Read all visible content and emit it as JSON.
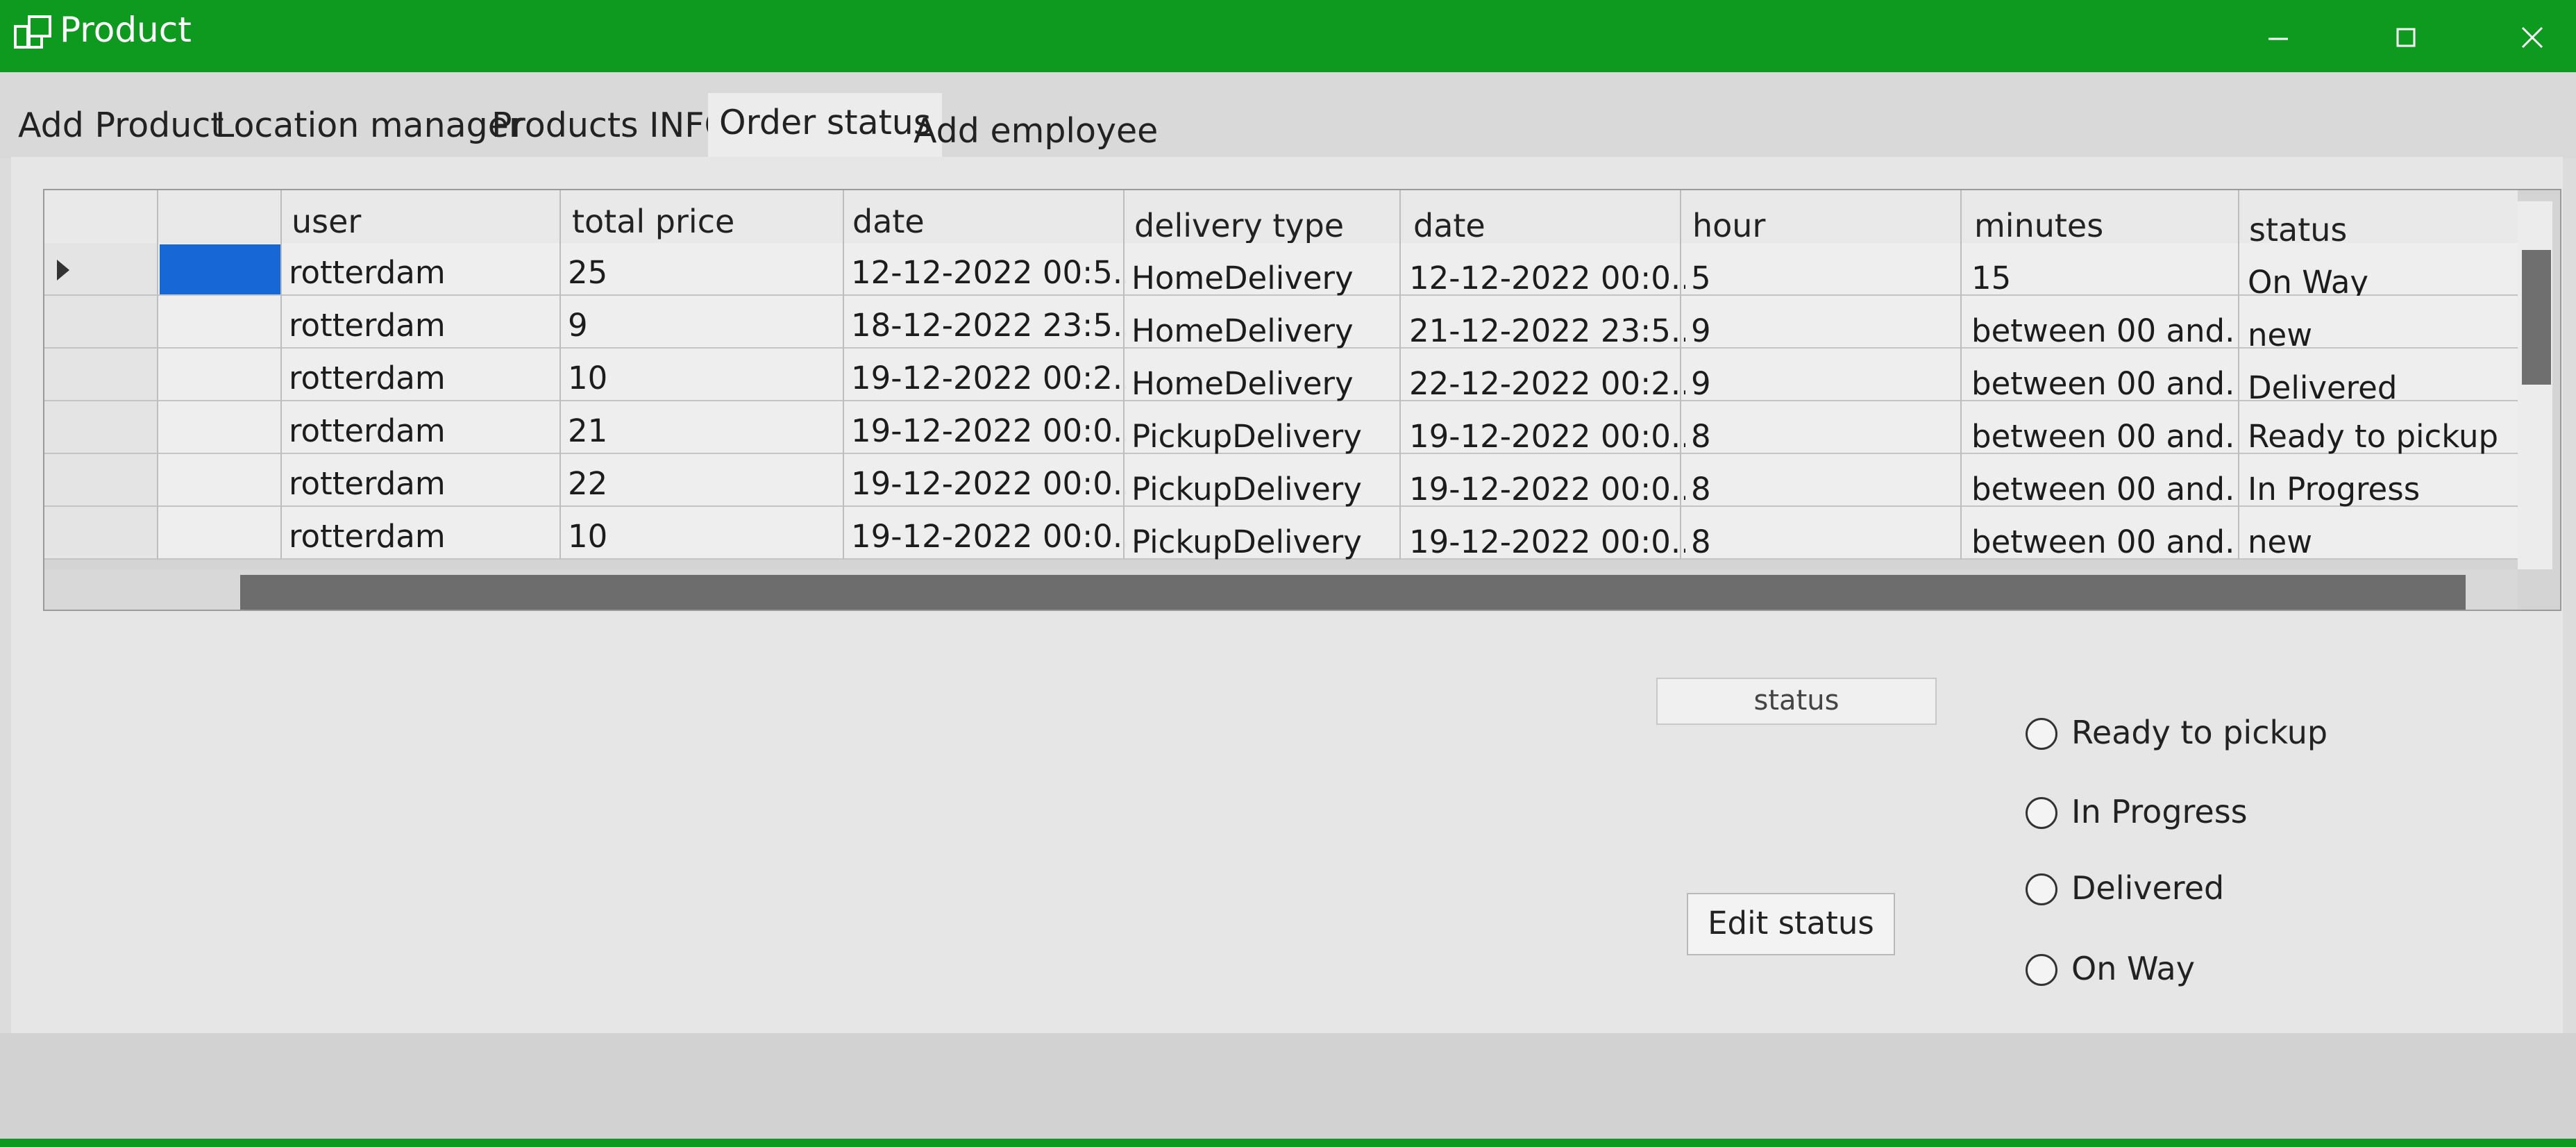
{
  "window": {
    "title": "Product",
    "controls": [
      "minimize",
      "maximize",
      "close"
    ]
  },
  "tabs": [
    {
      "label": "Add Product",
      "active": false
    },
    {
      "label": "Location manager",
      "active": false
    },
    {
      "label": "Products INFO",
      "active": false
    },
    {
      "label": "Order status",
      "active": true
    },
    {
      "label": "Add employee",
      "active": false
    }
  ],
  "grid": {
    "columns": [
      "",
      "user",
      "total price",
      "date",
      "delivery type",
      "date",
      "hour",
      "minutes",
      "status"
    ],
    "rows": [
      {
        "user": "rotterdam",
        "total_price": "25",
        "date": "12-12-2022 00:5...",
        "delivery_type": "HomeDelivery",
        "date2": "12-12-2022 00:0...",
        "hour": "5",
        "minutes": "15",
        "status": "On Way",
        "selected": true
      },
      {
        "user": "rotterdam",
        "total_price": "9",
        "date": "18-12-2022 23:5...",
        "delivery_type": "HomeDelivery",
        "date2": "21-12-2022 23:5...",
        "hour": "9",
        "minutes": "between 00 and...",
        "status": "new"
      },
      {
        "user": "rotterdam",
        "total_price": "10",
        "date": "19-12-2022 00:2...",
        "delivery_type": "HomeDelivery",
        "date2": "22-12-2022 00:2...",
        "hour": "9",
        "minutes": "between 00 and...",
        "status": "Delivered"
      },
      {
        "user": "rotterdam",
        "total_price": "21",
        "date": "19-12-2022 00:0...",
        "delivery_type": "PickupDelivery",
        "date2": "19-12-2022 00:0...",
        "hour": "8",
        "minutes": "between 00 and...",
        "status": "Ready to pickup"
      },
      {
        "user": "rotterdam",
        "total_price": "22",
        "date": "19-12-2022 00:0...",
        "delivery_type": "PickupDelivery",
        "date2": "19-12-2022 00:0...",
        "hour": "8",
        "minutes": "between 00 and...",
        "status": "In Progress"
      },
      {
        "user": "rotterdam",
        "total_price": "10",
        "date": "19-12-2022 00:0...",
        "delivery_type": "PickupDelivery",
        "date2": "19-12-2022 00:0...",
        "hour": "8",
        "minutes": "between 00 and...",
        "status": "new"
      }
    ]
  },
  "status_field": {
    "value": "status"
  },
  "edit_button": {
    "label": "Edit status"
  },
  "radio_options": [
    {
      "label": "Ready to pickup",
      "checked": false
    },
    {
      "label": "In Progress",
      "checked": false
    },
    {
      "label": "Delivered",
      "checked": false
    },
    {
      "label": "On Way",
      "checked": false
    }
  ],
  "colors": {
    "titlebar": "#0e9a1e",
    "selection": "#1767d6"
  }
}
